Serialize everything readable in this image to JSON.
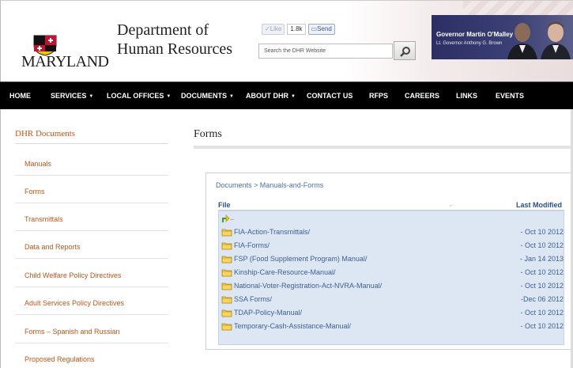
{
  "header": {
    "logo_text": "MARYLAND",
    "title_line1": "Department of",
    "title_line2": "Human Resources",
    "like_label": "Like",
    "like_count": "1.8k",
    "send_label": "Send",
    "search_placeholder": "Search the DHR Website",
    "governor": "Governor Martin O'Malley",
    "lt_governor": "Lt. Governor Anthony G. Brown"
  },
  "nav": [
    {
      "label": "HOME",
      "caret": false
    },
    {
      "label": "SERVICES",
      "caret": true
    },
    {
      "label": "LOCAL OFFICES",
      "caret": true
    },
    {
      "label": "DOCUMENTS",
      "caret": true
    },
    {
      "label": "ABOUT DHR",
      "caret": true
    },
    {
      "label": "CONTACT US",
      "caret": false
    },
    {
      "label": "RFPS",
      "caret": false
    },
    {
      "label": "CAREERS",
      "caret": false
    },
    {
      "label": "LINKS",
      "caret": false
    },
    {
      "label": "EVENTS",
      "caret": false
    }
  ],
  "sidebar": {
    "title": "DHR Documents",
    "items": [
      "Manuals",
      "Forms",
      "Transmittals",
      "Data and Reports",
      "Child Welfare Policy Directives",
      "Adult Services Policy Directives",
      "Forms – Spanish and Russian",
      "Proposed Regulations"
    ]
  },
  "main": {
    "page_title": "Forms",
    "breadcrumb": "Documents > Manuals-and-Forms",
    "col_file": "File",
    "col_dash": "-",
    "col_modified": "Last Modified",
    "parent_label": "..",
    "files": [
      {
        "name": "FIA-Action-Transmittals/",
        "date": "- Oct 10 2012"
      },
      {
        "name": "FIA-Forms/",
        "date": "- Oct 10 2012"
      },
      {
        "name": "FSP (Food Supplement Program) Manual/",
        "date": "- Jan 14 2013"
      },
      {
        "name": "Kinship-Care-Resource-Manual/",
        "date": "- Oct 10 2012"
      },
      {
        "name": "National-Voter-Registration-Act-NVRA-Manual/",
        "date": "- Oct 10 2012"
      },
      {
        "name": "SSA Forms/",
        "date": "-Dec 06 2012"
      },
      {
        "name": "TDAP-Policy-Manual/",
        "date": "- Oct 10 2012"
      },
      {
        "name": "Temporary-Cash-Assistance-Manual/",
        "date": "- Oct 10 2012"
      }
    ]
  },
  "colors": {
    "accent_orange": "#c0561a",
    "link_blue": "#3c5f96",
    "nav_black": "#000000",
    "row_bg": "#dde7f4"
  }
}
